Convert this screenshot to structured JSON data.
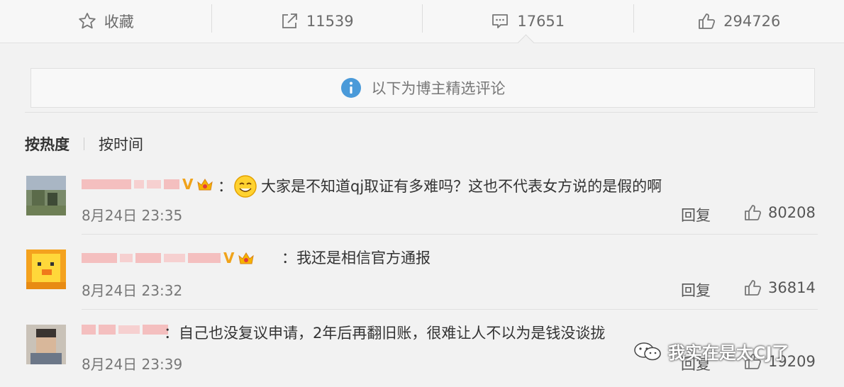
{
  "actions": {
    "favorite_label": "收藏",
    "share_count": "11539",
    "comment_count": "17651",
    "like_count": "294726"
  },
  "notice": {
    "text": "以下为博主精选评论"
  },
  "sort": {
    "hot_label": "按热度",
    "time_label": "按时间"
  },
  "comments": [
    {
      "text": "大家是不知道qj取证有多难吗？这也不代表女方说的是假的啊",
      "time": "8月24日 23:35",
      "reply_label": "回复",
      "likes": "80208"
    },
    {
      "text": "我还是相信官方通报",
      "time": "8月24日 23:32",
      "reply_label": "回复",
      "likes": "36814"
    },
    {
      "text": "自己也没复议申请，2年后再翻旧账，很难让人不以为是钱没谈拢",
      "time": "8月24日 23:39",
      "reply_label": "回复",
      "likes": "19209"
    }
  ],
  "separator": "：",
  "watermark": {
    "text": "我实在是太CJ了"
  },
  "colors": {
    "accent_blue": "#4a9ad9",
    "badge_gold": "#f0a31b",
    "background": "#f2f2f2"
  }
}
